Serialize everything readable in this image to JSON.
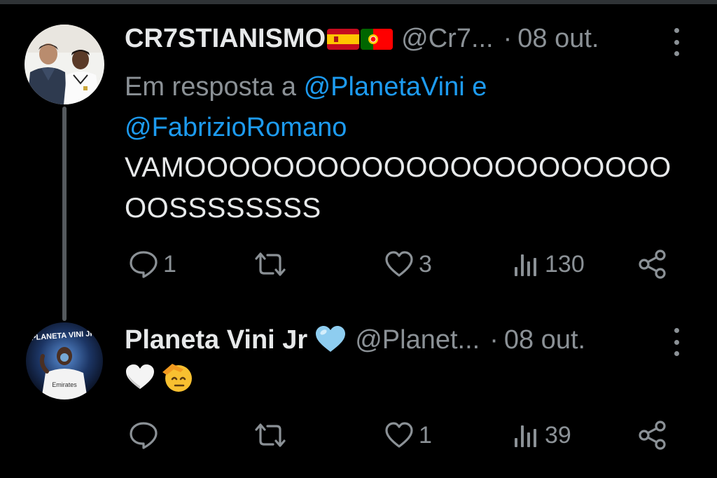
{
  "colors": {
    "background": "#000000",
    "text_primary": "#e7e9ea",
    "text_secondary": "#8b9196",
    "link": "#1d9bf0",
    "verified_badge": "#8ecdf0"
  },
  "tweets": [
    {
      "display_name": "CR7STIANISMO",
      "flags": [
        "spain-flag-icon",
        "portugal-flag-icon"
      ],
      "handle": "@Cr7...",
      "dot": "·",
      "date": "08 out.",
      "reply_prefix": "Em resposta a ",
      "reply_mention_1": "@PlanetaVini",
      "reply_conj": " e",
      "reply_mention_2": "@FabrizioRomano",
      "text_line_1": "VAMOOOOOOOOOOOOOOOOOOOOOO",
      "text_line_2": "OOSSSSSSSS",
      "actions": {
        "replies": "1",
        "retweets": "",
        "likes": "3",
        "views": "130"
      }
    },
    {
      "display_name": "Planeta Vini Jr",
      "badge": "light-blue-heart-icon",
      "handle": "@Planet...",
      "dot": "·",
      "date": "08 out.",
      "emojis": [
        "white-heart-emoji",
        "saluting-face-emoji"
      ],
      "actions": {
        "replies": "",
        "retweets": "",
        "likes": "1",
        "views": "39"
      }
    }
  ]
}
